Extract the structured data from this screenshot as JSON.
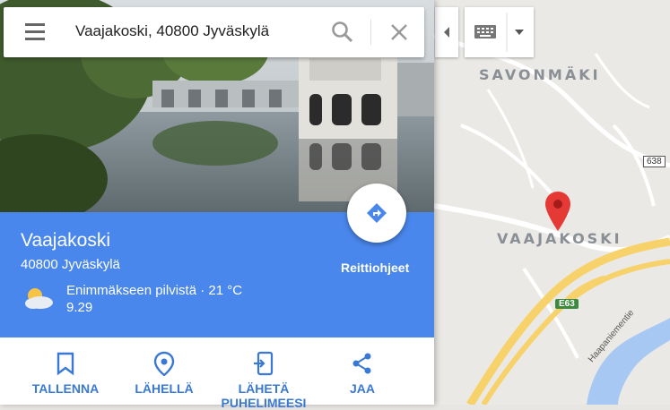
{
  "search": {
    "value": "Vaajakoski, 40800 Jyväskylä"
  },
  "place": {
    "name": "Vaajakoski",
    "address": "40800 Jyväskylä",
    "weather_line1": "Enimmäkseen pilvistä · 21 °C",
    "weather_line2": "9.29",
    "directions_label": "Reittiohjeet"
  },
  "actions": [
    {
      "label": "TALLENNA",
      "icon": "bookmark-icon"
    },
    {
      "label": "LÄHELLÄ",
      "icon": "nearby-icon"
    },
    {
      "label": "LÄHETÄ PUHELIMEESI",
      "icon": "send-to-phone-icon"
    },
    {
      "label": "JAA",
      "icon": "share-icon"
    }
  ],
  "map": {
    "labels": {
      "savonmaki": "SAVONMÄKI",
      "vaajakoski": "VAAJAKOSKI"
    },
    "road_shield": "638",
    "euro_route": "E63",
    "street": "Haapaniementie"
  },
  "colors": {
    "accent": "#4a87ec",
    "pin": "#e53935",
    "action_text": "#3a78d6"
  }
}
